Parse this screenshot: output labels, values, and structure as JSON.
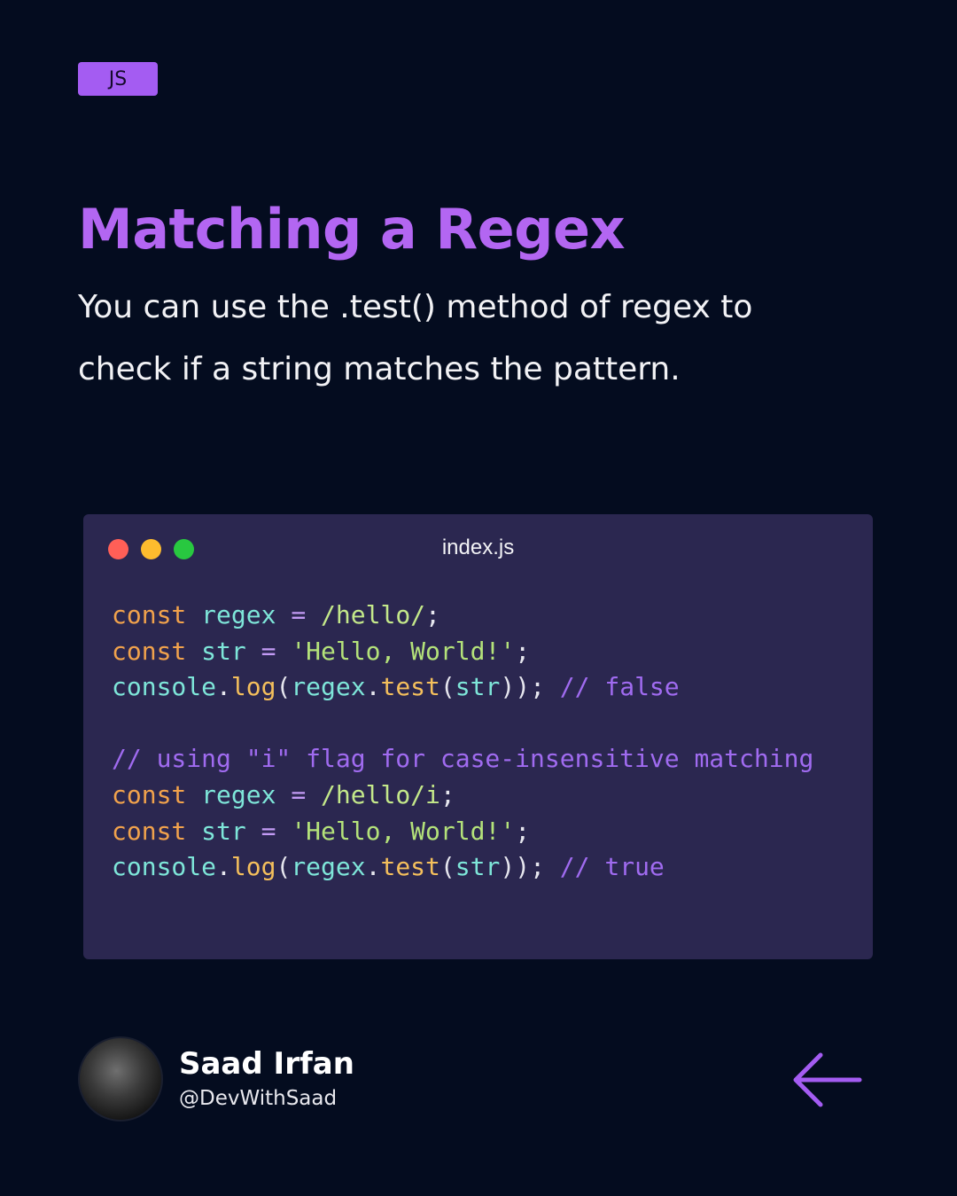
{
  "tag": "JS",
  "title": "Matching a Regex",
  "description": {
    "line1": "You can use the .test() method of regex to",
    "line2": "check if a string matches the pattern."
  },
  "editor": {
    "filename": "index.js",
    "window_buttons": [
      "close",
      "minimize",
      "maximize"
    ],
    "code_lines": [
      "const regex = /hello/;",
      "const str = 'Hello, World!';",
      "console.log(regex.test(str)); // false",
      "",
      "// using \"i\" flag for case-insensitive matching",
      "const regex = /hello/i;",
      "const str = 'Hello, World!';",
      "console.log(regex.test(str)); // true"
    ]
  },
  "author": {
    "name": "Saad Irfan",
    "handle": "@DevWithSaad"
  },
  "nav": {
    "icon": "arrow-left-icon"
  },
  "colors": {
    "background": "#040c1f",
    "accent": "#b366f2",
    "editor_background": "#2b2750"
  }
}
